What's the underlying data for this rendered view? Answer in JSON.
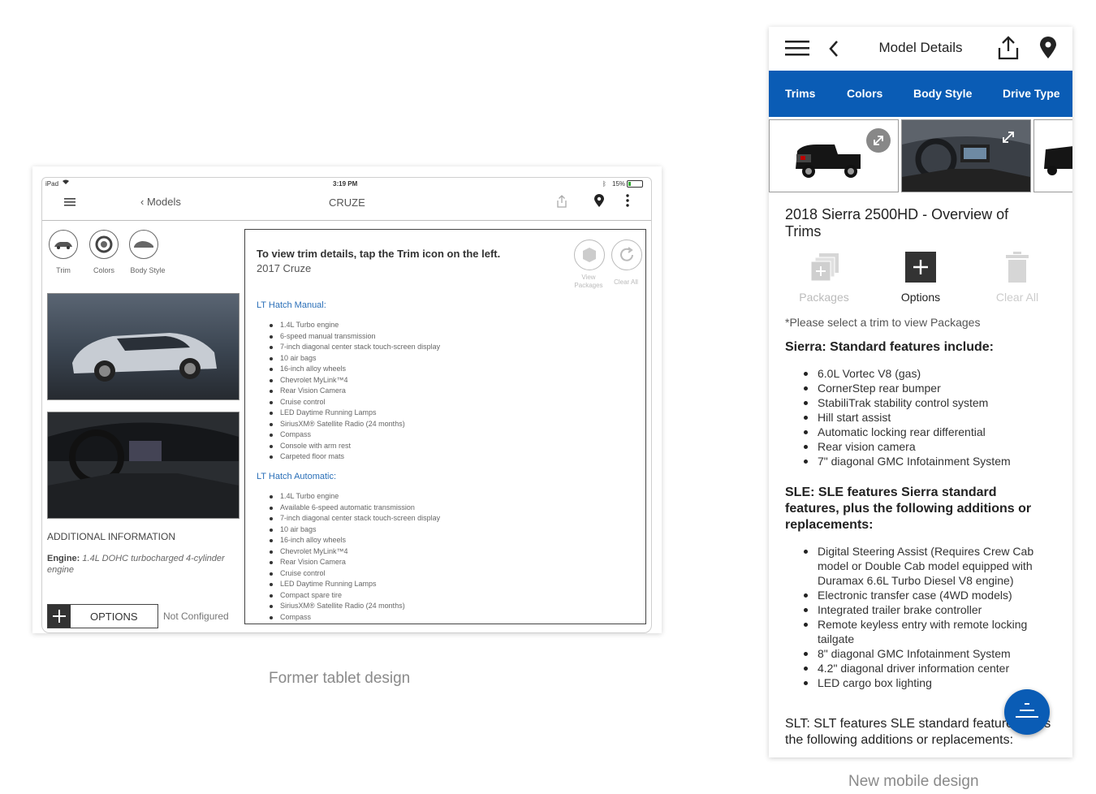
{
  "tablet": {
    "status": {
      "device": "iPad",
      "time": "3:19 PM",
      "battery": "15%"
    },
    "nav": {
      "back_label": "Models",
      "title": "CRUZE"
    },
    "icons": [
      {
        "label": "Trim"
      },
      {
        "label": "Colors"
      },
      {
        "label": "Body Style"
      }
    ],
    "additional_info_title": "ADDITIONAL INFORMATION",
    "engine_label": "Engine:",
    "engine_value": "1.4L DOHC turbocharged 4-cylinder engine",
    "options_label": "OPTIONS",
    "options_status": "Not Configured",
    "panel": {
      "instruction": "To view trim details, tap the Trim icon on the left.",
      "subtitle": "2017 Cruze",
      "view_packages": "View Packages",
      "clear_all": "Clear All",
      "sections": [
        {
          "title": "LT Hatch Manual:",
          "items": [
            "1.4L Turbo engine",
            "6-speed manual transmission",
            "7-inch diagonal center stack touch-screen display",
            "10 air bags",
            "16-inch alloy wheels",
            "Chevrolet MyLink™4",
            "Rear Vision Camera",
            "Cruise control",
            "LED Daytime Running Lamps",
            "SiriusXM® Satellite Radio (24 months)",
            "Compass",
            "Console with arm rest",
            "Carpeted floor mats"
          ]
        },
        {
          "title": "LT Hatch Automatic:",
          "items": [
            "1.4L Turbo engine",
            "Available 6-speed automatic transmission",
            "7-inch diagonal center stack touch-screen display",
            "10 air bags",
            "16-inch alloy wheels",
            "Chevrolet MyLink™4",
            "Rear Vision Camera",
            "Cruise control",
            "LED Daytime Running Lamps",
            "Compact spare tire",
            "SiriusXM® Satellite Radio (24 months)",
            "Compass"
          ]
        }
      ]
    },
    "caption": "Former tablet design"
  },
  "mobile": {
    "header_title": "Model Details",
    "tabs": [
      {
        "label": "Trims"
      },
      {
        "label": "Colors"
      },
      {
        "label": "Body Style"
      },
      {
        "label": "Drive Type"
      }
    ],
    "heading": "2018 Sierra 2500HD - Overview of Trims",
    "actions": [
      {
        "label": "Packages"
      },
      {
        "label": "Options"
      },
      {
        "label": "Clear All"
      }
    ],
    "note": "*Please select a trim to view Packages",
    "sections": [
      {
        "title": "Sierra: Standard features include:",
        "items": [
          "6.0L Vortec V8 (gas)",
          "CornerStep rear bumper",
          "StabiliTrak stability control system",
          "Hill start assist",
          "Automatic locking rear differential",
          "Rear vision camera",
          "7\" diagonal GMC Infotainment System"
        ]
      },
      {
        "title": "SLE: SLE features Sierra standard features, plus the following additions or replacements:",
        "items": [
          "Digital Steering Assist (Requires Crew Cab model or Double Cab model equipped with Duramax 6.6L Turbo Diesel V8 engine)",
          "Electronic transfer case (4WD models)",
          "Integrated trailer brake controller",
          "Remote keyless entry with remote locking tailgate",
          "8\" diagonal GMC Infotainment System",
          "4.2\" diagonal driver information center",
          "LED cargo box lighting"
        ]
      },
      {
        "title": "SLT: SLT features SLE standard features, plus the following additions or replacements:",
        "items": []
      }
    ],
    "accent": "#0a5cb5",
    "caption": "New mobile design"
  }
}
